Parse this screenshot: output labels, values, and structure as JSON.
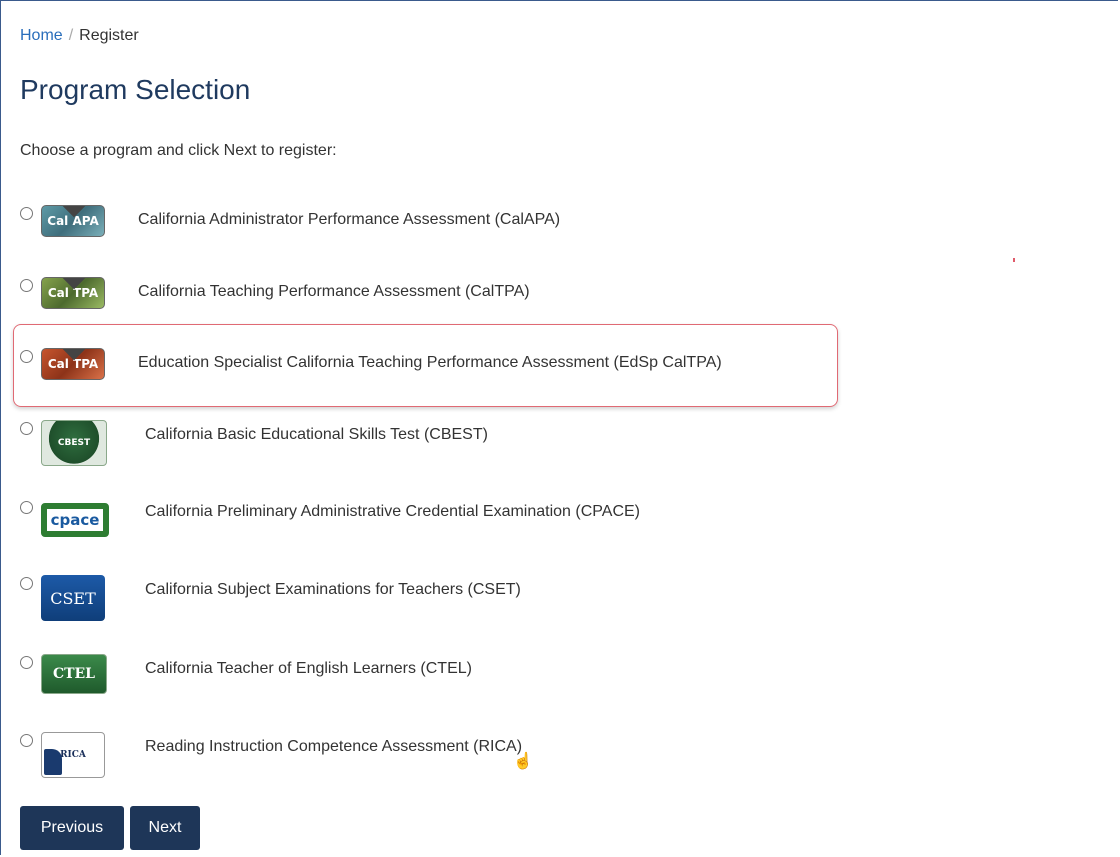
{
  "breadcrumb": {
    "home": "Home",
    "separator": "/",
    "current": "Register"
  },
  "page_title": "Program Selection",
  "intro": "Choose a program and click Next to register:",
  "programs": [
    {
      "logo_text": "Cal APA",
      "label": "California Administrator Performance Assessment (CalAPA)",
      "selected": false
    },
    {
      "logo_text": "Cal TPA",
      "label": "California Teaching Performance Assessment (CalTPA)",
      "selected": false
    },
    {
      "logo_text": "Cal TPA",
      "label": "Education Specialist California Teaching Performance Assessment (EdSp CalTPA)",
      "selected": false,
      "highlighted": true
    },
    {
      "logo_text": "CBEST",
      "label": "California Basic Educational Skills Test (CBEST)",
      "selected": false
    },
    {
      "logo_text": "cpace",
      "label": "California Preliminary Administrative Credential Examination (CPACE)",
      "selected": false
    },
    {
      "logo_text": "CSET",
      "label": "California Subject Examinations for Teachers (CSET)",
      "selected": false
    },
    {
      "logo_text": "CTEL",
      "label": "California Teacher of English Learners (CTEL)",
      "selected": false
    },
    {
      "logo_text": "RICA",
      "label": "Reading Instruction Competence Assessment (RICA)",
      "selected": false
    }
  ],
  "buttons": {
    "previous": "Previous",
    "next": "Next"
  },
  "colors": {
    "button_bg": "#1e3658",
    "highlight_border": "#e06a74",
    "title": "#1f3a5f",
    "link": "#2a6ebb"
  },
  "cursor_icon": "hand-pointer-icon"
}
